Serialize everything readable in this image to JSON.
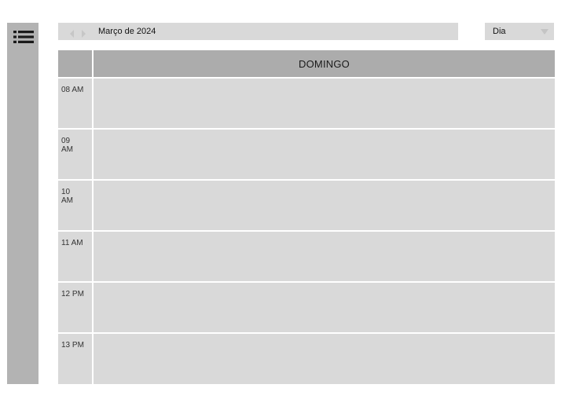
{
  "sidebar": {
    "menu_icon": "list-menu-icon"
  },
  "header": {
    "prev_icon": "chevron-left-icon",
    "next_icon": "chevron-right-icon",
    "date_label": "Março de 2024",
    "view": {
      "selected": "Dia",
      "caret_icon": "caret-down-icon"
    }
  },
  "calendar": {
    "day_label": "DOMINGO",
    "hours": [
      {
        "label": "08 AM"
      },
      {
        "label": "09 AM"
      },
      {
        "label": "10 AM"
      },
      {
        "label": "11 AM"
      },
      {
        "label": "12 PM"
      },
      {
        "label": "13 PM"
      }
    ]
  },
  "colors": {
    "sidebar": "#b3b3b3",
    "header_cell": "#acacac",
    "cell": "#d9d9d9",
    "arrow": "#c8c8c8"
  }
}
